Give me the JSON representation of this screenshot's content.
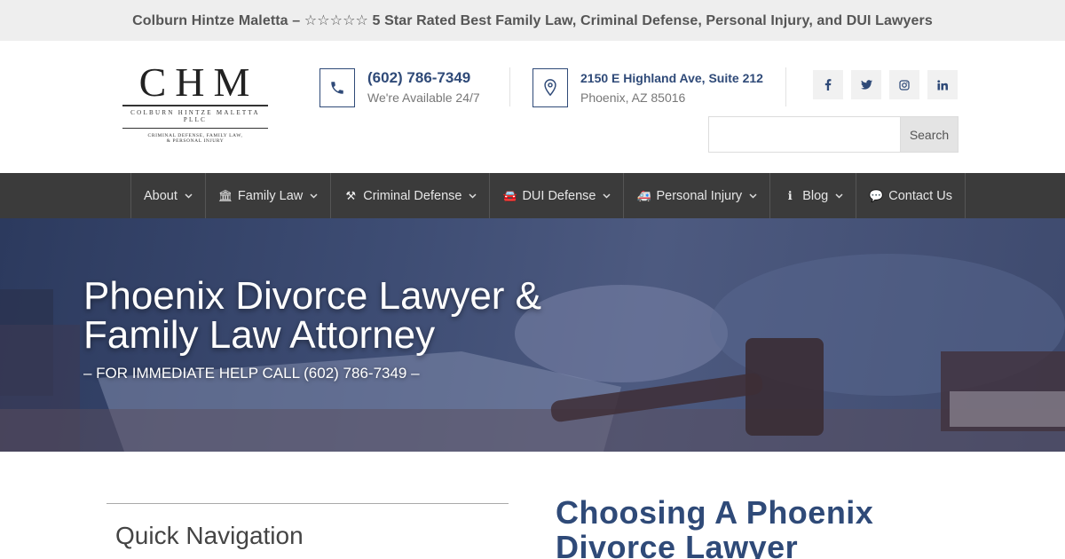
{
  "topbar": {
    "text": "Colburn Hintze Maletta – ☆☆☆☆☆ 5 Star Rated Best Family Law, Criminal Defense, Personal Injury, and DUI Lawyers"
  },
  "logo": {
    "mark": "CHM",
    "name": "COLBURN HINTZE MALETTA PLLC",
    "tagline_1": "CRIMINAL DEFENSE, FAMILY LAW,",
    "tagline_2": "& PERSONAL INJURY"
  },
  "contact": {
    "phone": "(602) 786-7349",
    "availability": "We're Available 24/7",
    "address_line_1": "2150 E Highland Ave, Suite 212",
    "address_line_2": "Phoenix, AZ 85016"
  },
  "social": [
    {
      "icon": "facebook-icon",
      "glyph": "f"
    },
    {
      "icon": "twitter-icon",
      "glyph": "🐦"
    },
    {
      "icon": "instagram-icon",
      "glyph": "◎"
    },
    {
      "icon": "linkedin-icon",
      "glyph": "in"
    }
  ],
  "search": {
    "placeholder": "",
    "button_label": "Search"
  },
  "nav": {
    "items": [
      {
        "label": "About",
        "icon": "",
        "icon_name": "",
        "has_dropdown": true
      },
      {
        "label": "Family Law",
        "icon": "🏛",
        "icon_name": "courthouse-icon",
        "has_dropdown": true
      },
      {
        "label": "Criminal Defense",
        "icon": "⚒",
        "icon_name": "gavel-icon",
        "has_dropdown": true
      },
      {
        "label": "DUI Defense",
        "icon": "🚘",
        "icon_name": "car-icon",
        "has_dropdown": true
      },
      {
        "label": "Personal Injury",
        "icon": "🚑",
        "icon_name": "ambulance-icon",
        "has_dropdown": true
      },
      {
        "label": "Blog",
        "icon": "ℹ",
        "icon_name": "info-icon",
        "has_dropdown": true
      },
      {
        "label": "Contact Us",
        "icon": "💬",
        "icon_name": "chat-icon",
        "has_dropdown": false
      }
    ]
  },
  "hero": {
    "title_line_1": "Phoenix Divorce Lawyer &",
    "title_line_2": "Family Law Attorney",
    "subtitle": "– FOR IMMEDIATE HELP CALL (602) 786-7349 –"
  },
  "sidebar": {
    "quick_nav_title": "Quick Navigation"
  },
  "article": {
    "title_line_1": "Choosing A Phoenix",
    "title_line_2": "Divorce Lawyer"
  },
  "colors": {
    "brand_blue": "#2f4a78",
    "nav_bg": "#3b3b3b",
    "topbar_bg": "#eeeeee"
  }
}
